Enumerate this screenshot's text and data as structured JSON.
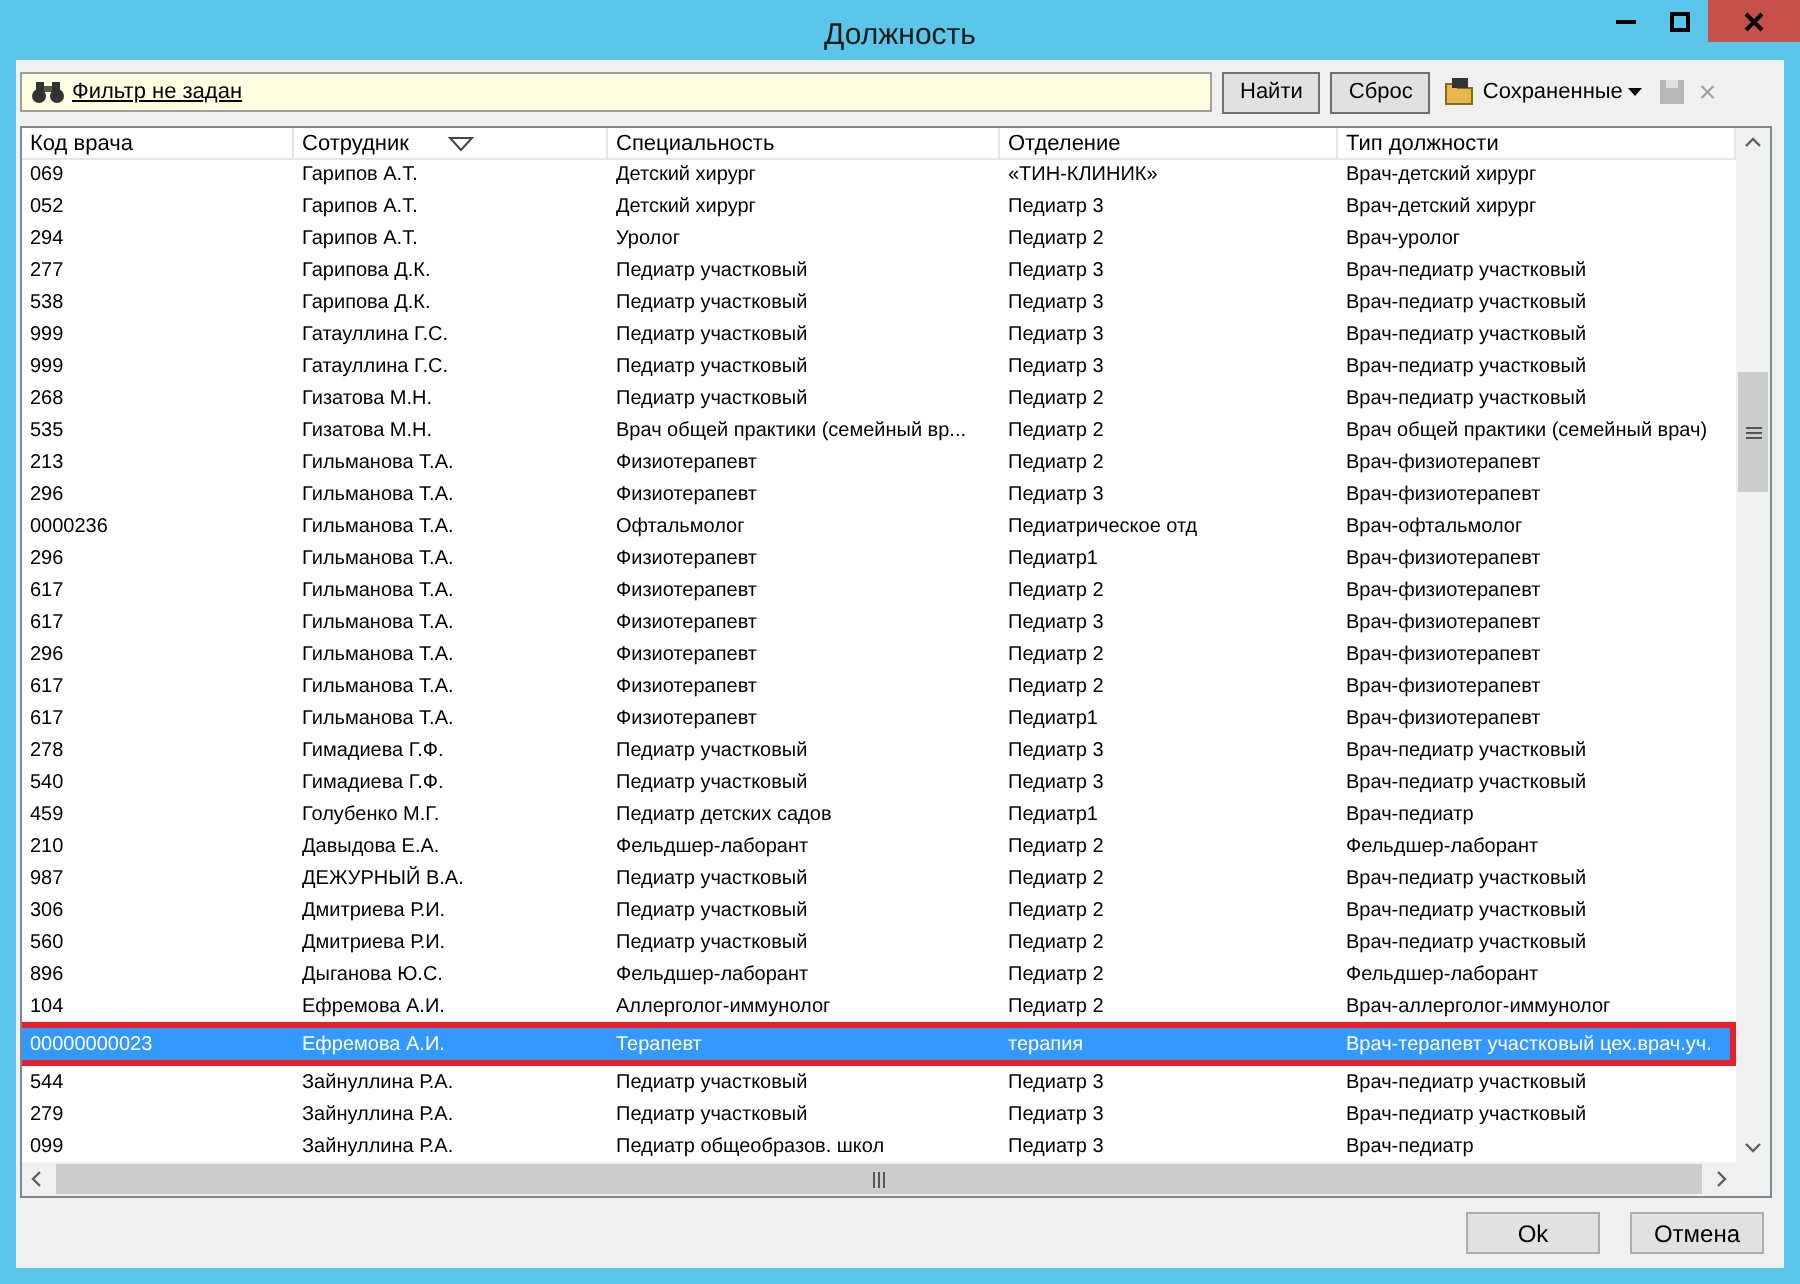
{
  "window": {
    "title": "Должность"
  },
  "toolbar": {
    "filter": "Фильтр не задан",
    "find_button": "Найти",
    "reset_button": "Сброс",
    "saved_menu": "Сохраненные",
    "clear_symbol": "×"
  },
  "table": {
    "columns": [
      {
        "label": "Код врача",
        "sorted": false
      },
      {
        "label": "Сотрудник",
        "sorted": true
      },
      {
        "label": "Специальность",
        "sorted": false
      },
      {
        "label": "Отделение",
        "sorted": false
      },
      {
        "label": "Тип должности",
        "sorted": false
      }
    ],
    "rows": [
      {
        "cells": [
          "069",
          "Гарипов А.Т.",
          "Детский хирург",
          "«ТИН-КЛИНИК»",
          "Врач-детский хирург"
        ],
        "selected": false
      },
      {
        "cells": [
          "052",
          "Гарипов А.Т.",
          "Детский хирург",
          "Педиатр 3",
          "Врач-детский хирург"
        ],
        "selected": false
      },
      {
        "cells": [
          "294",
          "Гарипов А.Т.",
          "Уролог",
          "Педиатр 2",
          "Врач-уролог"
        ],
        "selected": false
      },
      {
        "cells": [
          "277",
          "Гарипова Д.К.",
          "Педиатр участковый",
          "Педиатр 3",
          "Врач-педиатр участковый"
        ],
        "selected": false
      },
      {
        "cells": [
          "538",
          "Гарипова Д.К.",
          "Педиатр участковый",
          "Педиатр 3",
          "Врач-педиатр участковый"
        ],
        "selected": false
      },
      {
        "cells": [
          "999",
          "Гатауллина Г.С.",
          "Педиатр участковый",
          "Педиатр 3",
          "Врач-педиатр участковый"
        ],
        "selected": false
      },
      {
        "cells": [
          "999",
          "Гатауллина Г.С.",
          "Педиатр участковый",
          "Педиатр 3",
          "Врач-педиатр участковый"
        ],
        "selected": false
      },
      {
        "cells": [
          "268",
          "Гизатова М.Н.",
          "Педиатр участковый",
          "Педиатр 2",
          "Врач-педиатр участковый"
        ],
        "selected": false
      },
      {
        "cells": [
          "535",
          "Гизатова М.Н.",
          "Врач общей практики (семейный вр...",
          "Педиатр 2",
          "Врач общей практики (семейный врач)"
        ],
        "selected": false
      },
      {
        "cells": [
          "213",
          "Гильманова Т.А.",
          "Физиотерапевт",
          "Педиатр 2",
          "Врач-физиотерапевт"
        ],
        "selected": false
      },
      {
        "cells": [
          "296",
          "Гильманова Т.А.",
          "Физиотерапевт",
          "Педиатр 3",
          "Врач-физиотерапевт"
        ],
        "selected": false
      },
      {
        "cells": [
          "0000236",
          "Гильманова Т.А.",
          "Офтальмолог",
          "Педиатрическое отд",
          "Врач-офтальмолог"
        ],
        "selected": false
      },
      {
        "cells": [
          "296",
          "Гильманова Т.А.",
          "Физиотерапевт",
          "Педиатр1",
          "Врач-физиотерапевт"
        ],
        "selected": false
      },
      {
        "cells": [
          "617",
          "Гильманова Т.А.",
          "Физиотерапевт",
          "Педиатр 2",
          "Врач-физиотерапевт"
        ],
        "selected": false
      },
      {
        "cells": [
          "617",
          "Гильманова Т.А.",
          "Физиотерапевт",
          "Педиатр 3",
          "Врач-физиотерапевт"
        ],
        "selected": false
      },
      {
        "cells": [
          "296",
          "Гильманова Т.А.",
          "Физиотерапевт",
          "Педиатр 2",
          "Врач-физиотерапевт"
        ],
        "selected": false
      },
      {
        "cells": [
          "617",
          "Гильманова Т.А.",
          "Физиотерапевт",
          "Педиатр 2",
          "Врач-физиотерапевт"
        ],
        "selected": false
      },
      {
        "cells": [
          "617",
          "Гильманова Т.А.",
          "Физиотерапевт",
          "Педиатр1",
          "Врач-физиотерапевт"
        ],
        "selected": false
      },
      {
        "cells": [
          "278",
          "Гимадиева Г.Ф.",
          "Педиатр участковый",
          "Педиатр 3",
          "Врач-педиатр участковый"
        ],
        "selected": false
      },
      {
        "cells": [
          "540",
          "Гимадиева Г.Ф.",
          "Педиатр участковый",
          "Педиатр 3",
          "Врач-педиатр участковый"
        ],
        "selected": false
      },
      {
        "cells": [
          "459",
          "Голубенко М.Г.",
          "Педиатр детских садов",
          "Педиатр1",
          "Врач-педиатр"
        ],
        "selected": false
      },
      {
        "cells": [
          "210",
          "Давыдова Е.А.",
          "Фельдшер-лаборант",
          "Педиатр 2",
          "Фельдшер-лаборант"
        ],
        "selected": false
      },
      {
        "cells": [
          "987",
          "ДЕЖУРНЫЙ В.А.",
          "Педиатр участковый",
          "Педиатр 2",
          "Врач-педиатр участковый"
        ],
        "selected": false
      },
      {
        "cells": [
          "306",
          "Дмитриева Р.И.",
          "Педиатр участковый",
          "Педиатр 2",
          "Врач-педиатр участковый"
        ],
        "selected": false
      },
      {
        "cells": [
          "560",
          "Дмитриева Р.И.",
          "Педиатр участковый",
          "Педиатр 2",
          "Врач-педиатр участковый"
        ],
        "selected": false
      },
      {
        "cells": [
          "896",
          "Дыганова Ю.С.",
          "Фельдшер-лаборант",
          "Педиатр 2",
          "Фельдшер-лаборант"
        ],
        "selected": false
      },
      {
        "cells": [
          "104",
          "Ефремова А.И.",
          "Аллерголог-иммунолог",
          "Педиатр 2",
          "Врач-аллерголог-иммунолог"
        ],
        "selected": false
      },
      {
        "cells": [
          "00000000023",
          "Ефремова А.И.",
          "Терапевт",
          "терапия",
          "Врач-терапевт участковый цех.врач.уч."
        ],
        "selected": true
      },
      {
        "cells": [
          "544",
          "Зайнуллина Р.А.",
          "Педиатр участковый",
          "Педиатр 3",
          "Врач-педиатр участковый"
        ],
        "selected": false
      },
      {
        "cells": [
          "279",
          "Зайнуллина Р.А.",
          "Педиатр участковый",
          "Педиатр 3",
          "Врач-педиатр участковый"
        ],
        "selected": false
      },
      {
        "cells": [
          "099",
          "Зайнуллина Р.А.",
          "Педиатр общеобразов. школ",
          "Педиатр 3",
          "Врач-педиатр"
        ],
        "selected": false
      }
    ]
  },
  "buttons": [
    "Ok",
    "Отмена"
  ]
}
